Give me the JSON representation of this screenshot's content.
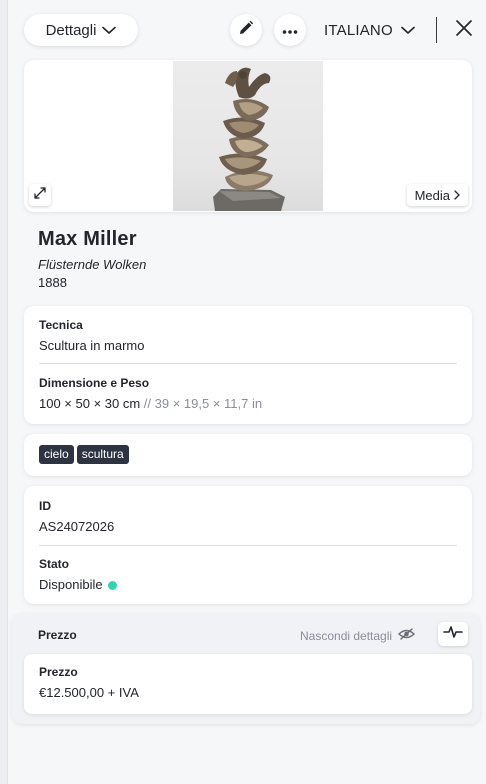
{
  "topbar": {
    "details_label": "Dettagli",
    "language_label": "ITALIANO"
  },
  "media": {
    "media_label": "Media"
  },
  "artist": {
    "name": "Max Miller",
    "artwork_title": "Flüsternde Wolken",
    "year": "1888"
  },
  "technique": {
    "label": "Tecnica",
    "value": "Scultura in marmo"
  },
  "dimensions": {
    "label": "Dimensione e Peso",
    "metric": "100 × 50 × 30 cm",
    "imperial": " // 39 × 19,5 × 11,7 in"
  },
  "tags": [
    "cielo",
    "scultura"
  ],
  "identifier": {
    "label": "ID",
    "value": "AS24072026"
  },
  "status": {
    "label": "Stato",
    "value": "Disponibile",
    "color": "#2ed6b0"
  },
  "price_section": {
    "title": "Prezzo",
    "hide_details_label": "Nascondi dettagli",
    "price_label": "Prezzo",
    "price_value": "€12.500,00 + IVA"
  }
}
